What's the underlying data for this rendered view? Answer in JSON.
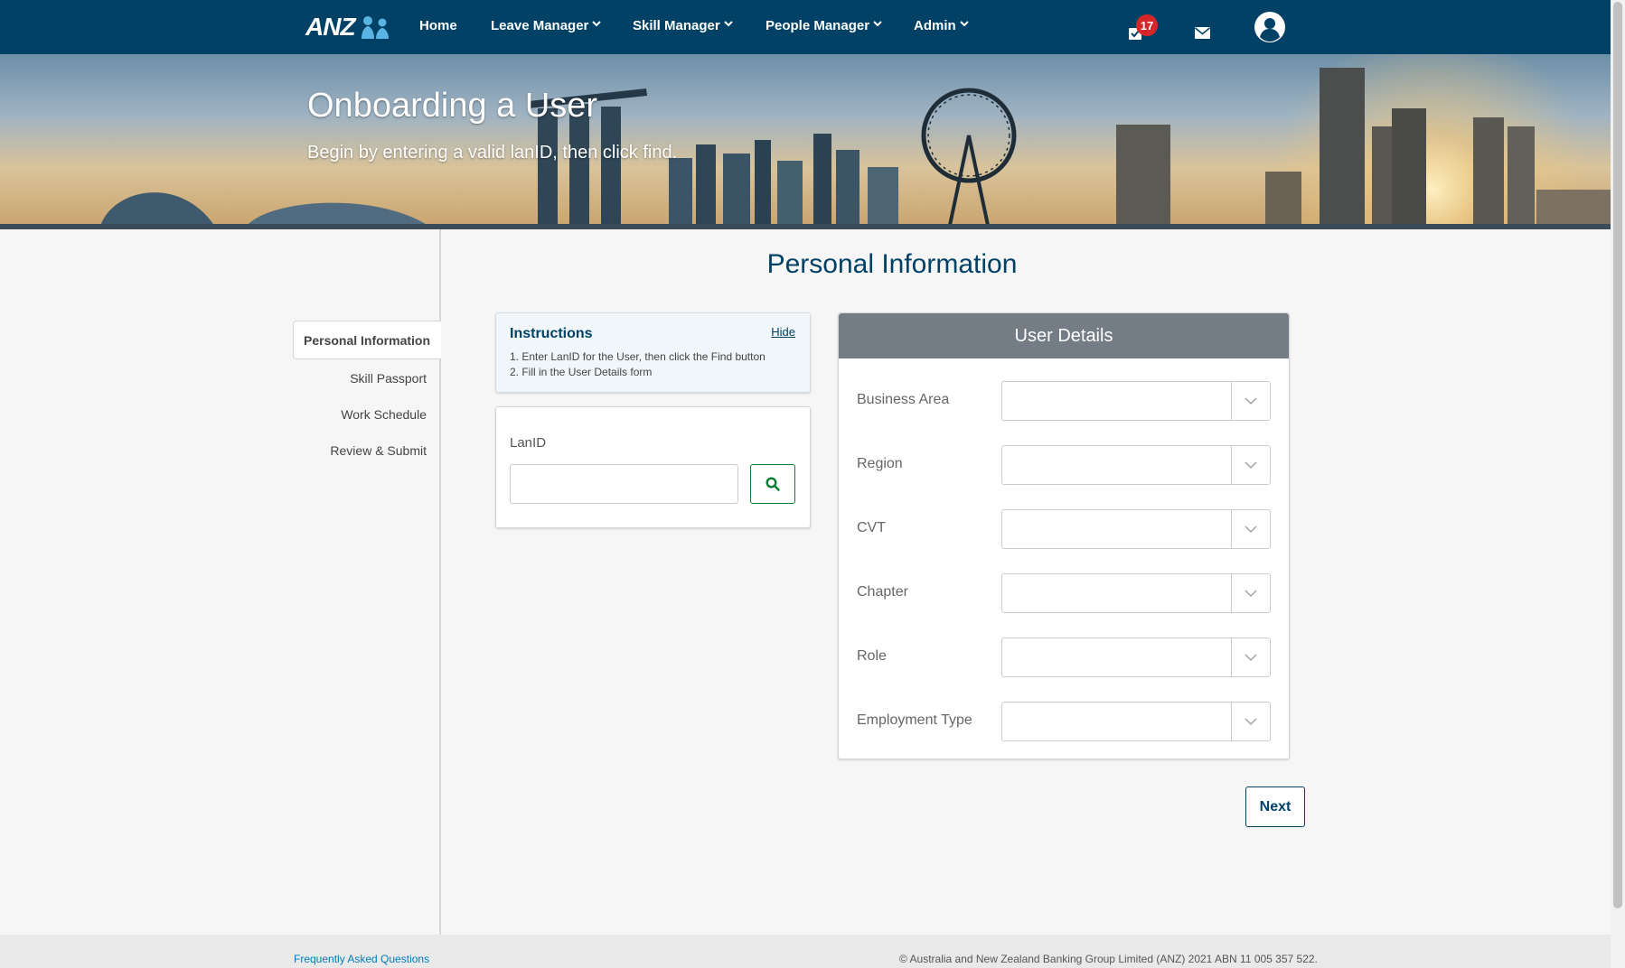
{
  "nav": {
    "logo_text": "ANZ",
    "items": [
      {
        "label": "Home",
        "dropdown": false
      },
      {
        "label": "Leave Manager",
        "dropdown": true
      },
      {
        "label": "Skill Manager",
        "dropdown": true
      },
      {
        "label": "People Manager",
        "dropdown": true
      },
      {
        "label": "Admin",
        "dropdown": true
      }
    ],
    "notifications_count": "17",
    "icons": [
      "tasks-icon",
      "mail-icon",
      "user-avatar-icon"
    ]
  },
  "hero": {
    "title": "Onboarding a User",
    "subtitle": "Begin by entering a valid lanID, then click find."
  },
  "sidebar": {
    "items": [
      {
        "label": "Personal Information",
        "active": true
      },
      {
        "label": "Skill Passport",
        "active": false
      },
      {
        "label": "Work Schedule",
        "active": false
      },
      {
        "label": "Review & Submit",
        "active": false
      }
    ]
  },
  "page_title": "Personal Information",
  "instructions": {
    "title": "Instructions",
    "hide_label": "Hide",
    "lines": [
      "1. Enter LanID for the User, then click the Find button",
      "2. Fill in the User Details form"
    ]
  },
  "lanid": {
    "label": "LanID",
    "value": "",
    "placeholder": ""
  },
  "user_details": {
    "title": "User Details",
    "fields": [
      {
        "label": "Business Area",
        "value": ""
      },
      {
        "label": "Region",
        "value": ""
      },
      {
        "label": "CVT",
        "value": ""
      },
      {
        "label": "Chapter",
        "value": ""
      },
      {
        "label": "Role",
        "value": ""
      },
      {
        "label": "Employment Type",
        "value": ""
      }
    ]
  },
  "next_label": "Next",
  "footer": {
    "faq_label": "Frequently Asked Questions",
    "copyright": "© Australia and New Zealand Banking Group Limited (ANZ) 2021 ABN 11 005 357 522."
  },
  "colors": {
    "nav_bg": "#004165",
    "badge": "#d7262a",
    "find_button": "#0b7d33",
    "card_header": "#747c85",
    "link": "#007dba"
  }
}
